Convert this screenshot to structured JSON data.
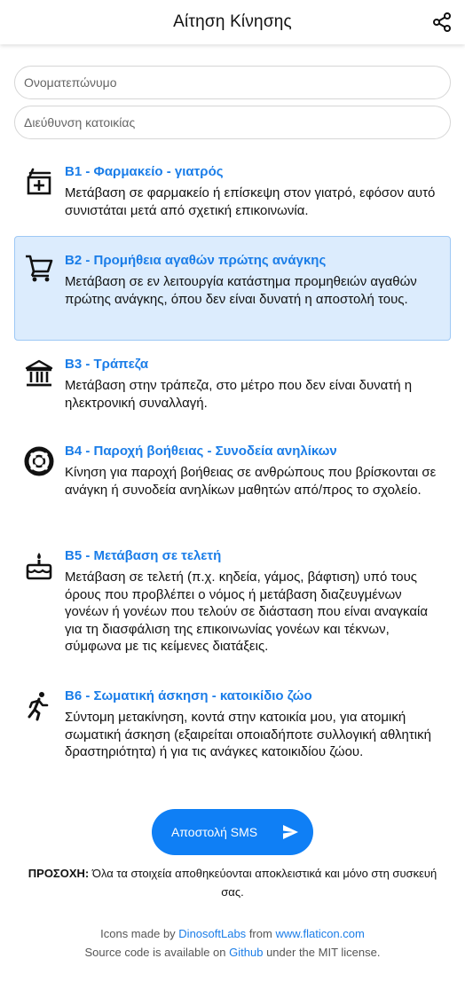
{
  "header": {
    "title": "Αίτηση Κίνησης",
    "share_icon": "share-icon"
  },
  "form": {
    "name_placeholder": "Ονοματεπώνυμο",
    "address_placeholder": "Διεύθυνση κατοικίας"
  },
  "options": [
    {
      "code": "B1",
      "title": "B1 - Φαρμακείο - γιατρός",
      "description": "Μετάβαση σε φαρμακείο ή επίσκεψη στον γιατρό, εφόσον αυτό συνιστάται μετά από σχετική επικοινωνία.",
      "icon": "pharmacy-icon",
      "selected": false
    },
    {
      "code": "B2",
      "title": "B2 - Προμήθεια αγαθών πρώτης ανάγκης",
      "description": "Μετάβαση σε εν λειτουργία κατάστημα προμηθειών αγαθών πρώτης ανάγκης, όπου δεν είναι δυνατή η αποστολή τους.",
      "icon": "shopping-cart-icon",
      "selected": true
    },
    {
      "code": "B3",
      "title": "B3 - Τράπεζα",
      "description": "Μετάβαση στην τράπεζα, στο μέτρο που δεν είναι δυνατή η ηλεκτρονική συναλλαγή.",
      "icon": "bank-icon",
      "selected": false
    },
    {
      "code": "B4",
      "title": "B4 - Παροχή βοήθειας - Συνοδεία ανηλίκων",
      "description": "Κίνηση για παροχή βοήθειας σε ανθρώπους που βρίσκονται σε ανάγκη ή συνοδεία ανηλίκων μαθητών από/προς το σχολείο.",
      "icon": "lifebuoy-icon",
      "selected": false
    },
    {
      "code": "B5",
      "title": "B5 - Μετάβαση σε τελετή",
      "description": "Μετάβαση σε τελετή (π.χ. κηδεία, γάμος, βάφτιση) υπό τους όρους που προβλέπει ο νόμος ή μετάβαση διαζευγμένων γονέων ή γονέων που τελούν σε διάσταση που είναι αναγκαία για τη διασφάλιση της επικοινωνίας γονέων και τέκνων, σύμφωνα με τις κείμενες διατάξεις.",
      "icon": "cake-icon",
      "selected": false
    },
    {
      "code": "B6",
      "title": "B6 - Σωματική άσκηση - κατοικίδιο ζώο",
      "description": "Σύντομη μετακίνηση, κοντά στην κατοικία μου, για ατομική σωματική άσκηση (εξαιρείται οποιαδήποτε συλλογική αθλητική δραστηριότητα) ή για τις ανάγκες κατοικιδίου ζώου.",
      "icon": "running-person-icon",
      "selected": false
    }
  ],
  "send_button": {
    "label": "Αποστολή SMS",
    "icon": "send-icon"
  },
  "warning": {
    "prefix": "ΠΡΟΣΟΧΗ:",
    "text": "Όλα τα στοιχεία αποθηκεύονται αποκλειστικά και μόνο στη συσκευή σας."
  },
  "credits": {
    "icons_prefix": "Icons made by",
    "icons_author": "DinosoftLabs",
    "icons_from": "from",
    "icons_site": "www.flaticon.com",
    "source_prefix": "Source code is available on",
    "source_link": "Github",
    "source_suffix": "under the MIT license."
  },
  "colors": {
    "accent": "#1a7de8",
    "button": "#0f7ff5",
    "selected_bg": "#dcecfd",
    "selected_border": "#9ec8f5"
  }
}
